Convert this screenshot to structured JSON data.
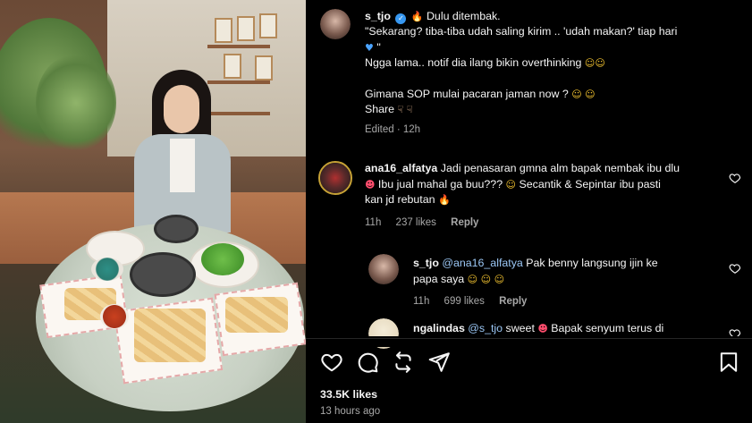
{
  "post": {
    "username": "s_tjo",
    "caption_line1": "Dulu ditembak.",
    "caption_line2": "\"Sekarang? tiba-tiba udah saling kirim .. 'udah makan?' tiap hari",
    "caption_line3": "Ngga lama.. notif dia ilang bikin overthinking",
    "caption_line4": "Gimana SOP mulai pacaran jaman now ?",
    "caption_line5": "Share",
    "edited_label": "Edited",
    "edited_time": "12h"
  },
  "comments": [
    {
      "username": "ana16_alfatya",
      "text_part1": "Jadi penasaran gmna alm bapak nembak ibu dlu",
      "text_part2": "Ibu jual mahal ga buu???",
      "text_part3": "Secantik & Sepintar ibu pasti",
      "text_part4": "kan jd rebutan",
      "time": "11h",
      "likes": "237 likes",
      "reply_label": "Reply"
    },
    {
      "username": "s_tjo",
      "mention": "@ana16_alfatya",
      "text_part1": "Pak benny langsung ijin ke",
      "text_part2": "papa saya",
      "time": "11h",
      "likes": "699 likes",
      "reply_label": "Reply"
    },
    {
      "username": "ngalindas",
      "mention": "@s_tjo",
      "text_part1": "sweet",
      "text_part2": "Bapak senyum terus di"
    }
  ],
  "footer": {
    "likes": "33.5K likes",
    "time": "13 hours ago"
  },
  "icons": {
    "like": "heart-icon",
    "comment": "comment-icon",
    "repost": "repost-icon",
    "share": "send-icon",
    "save": "bookmark-icon"
  },
  "colors": {
    "background": "#000000",
    "verified": "#3797f0",
    "meta": "#a8a8a8",
    "mention": "#9bc7f5"
  }
}
